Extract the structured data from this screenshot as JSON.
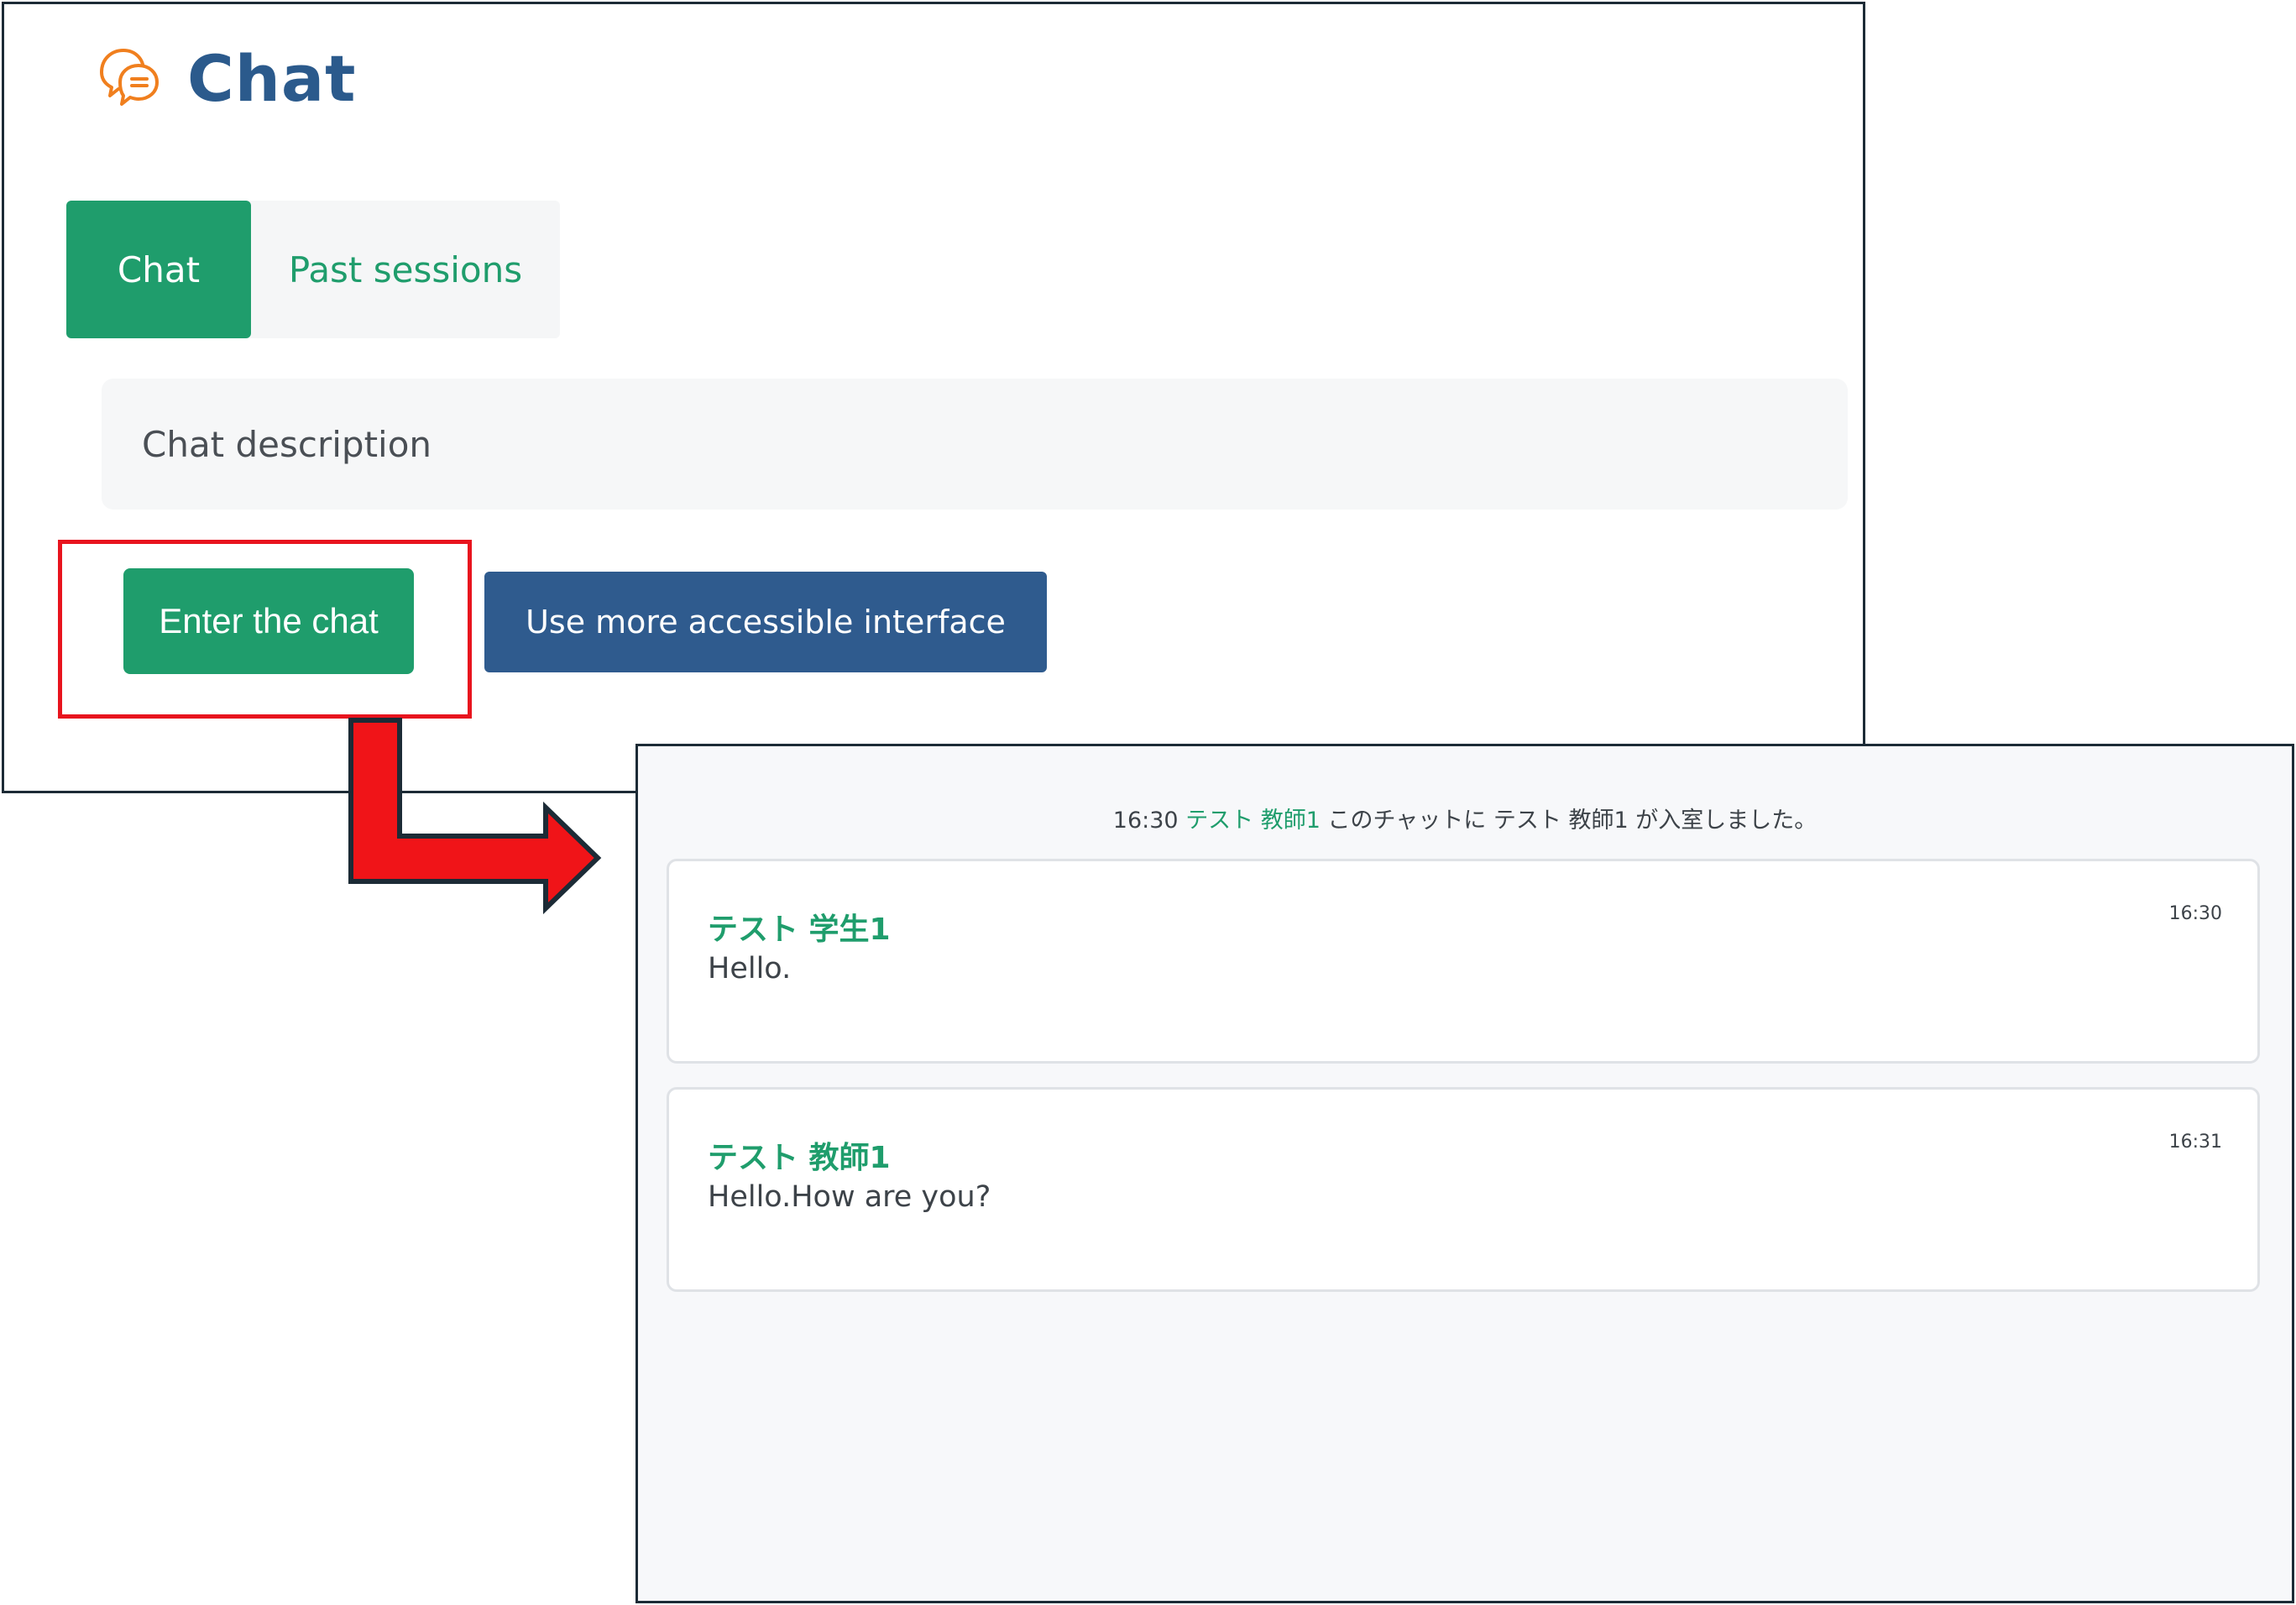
{
  "header": {
    "title": "Chat",
    "icon": "chat-bubbles-icon",
    "icon_color": "#f07f1e",
    "title_color": "#2b5a8c"
  },
  "tabs": [
    {
      "label": "Chat",
      "active": true
    },
    {
      "label": "Past sessions",
      "active": false
    }
  ],
  "description": "Chat description",
  "buttons": {
    "enter_chat": "Enter the chat",
    "accessible": "Use more accessible interface"
  },
  "colors": {
    "primary_green": "#1f9d6c",
    "primary_blue": "#2f5b8e",
    "highlight_red": "#e8141e"
  },
  "chat_room": {
    "system_message": {
      "time": "16:30",
      "user": "テスト 教師1",
      "text": "このチャットに テスト 教師1 が入室しました。"
    },
    "messages": [
      {
        "author": "テスト 学生1",
        "text": "Hello.",
        "time": "16:30"
      },
      {
        "author": "テスト 教師1",
        "text": "Hello.How are you?",
        "time": "16:31"
      }
    ]
  }
}
